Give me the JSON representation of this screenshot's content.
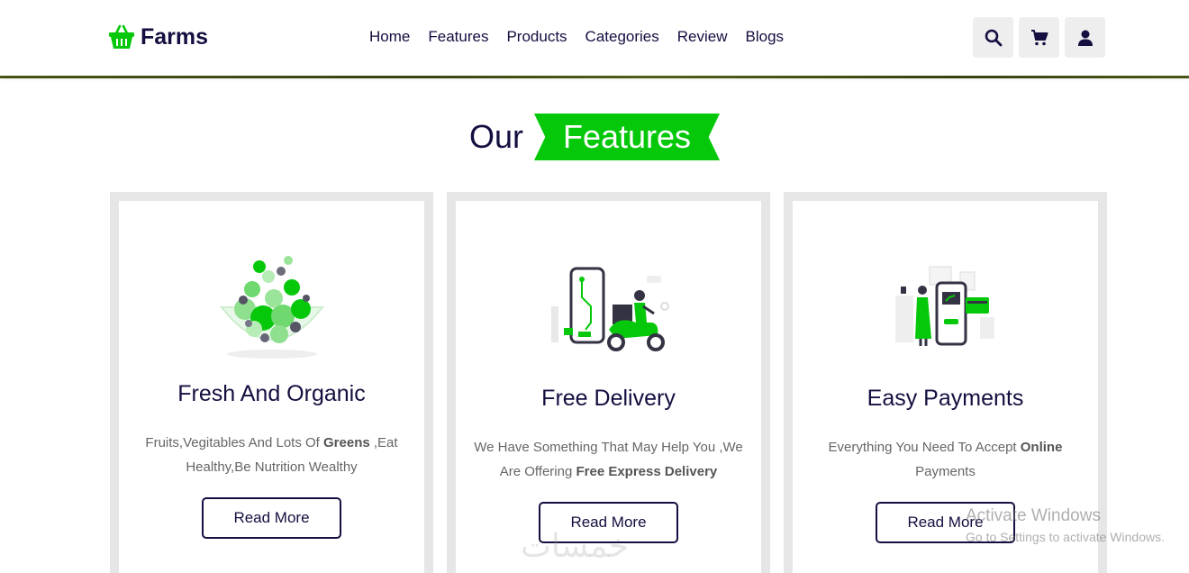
{
  "header": {
    "logo_text": "Farms",
    "nav": [
      "Home",
      "Features",
      "Products",
      "Categories",
      "Review",
      "Blogs"
    ],
    "icons": [
      "search-icon",
      "cart-icon",
      "user-icon"
    ]
  },
  "section": {
    "heading_prefix": "Our",
    "heading_tag": "Features"
  },
  "cards": [
    {
      "title": "Fresh And Organic",
      "text_a": "Fruits,Vegitables And Lots Of ",
      "text_bold": "Greens",
      "text_b": " ,Eat Healthy,Be Nutrition Wealthy",
      "button": "Read More",
      "illustration": "salad-bowl-illustration"
    },
    {
      "title": "Free Delivery",
      "text_a": "We Have Something That May Help You ,We Are Offering ",
      "text_bold": "Free Express Delivery",
      "text_b": "",
      "button": "Read More",
      "illustration": "delivery-scooter-illustration"
    },
    {
      "title": "Easy Payments",
      "text_a": "Everything You Need To Accept ",
      "text_bold": "Online",
      "text_b": " Payments",
      "button": "Read More",
      "illustration": "mobile-payment-illustration"
    }
  ],
  "watermark": {
    "title": "Activate Windows",
    "subtitle": "Go to Settings to activate Windows.",
    "arabic": "خمسات"
  },
  "colors": {
    "brand_green": "#06c80b",
    "navy": "#130f40",
    "card_border": "#e6e6e6",
    "icon_bg": "#eeeeee"
  }
}
